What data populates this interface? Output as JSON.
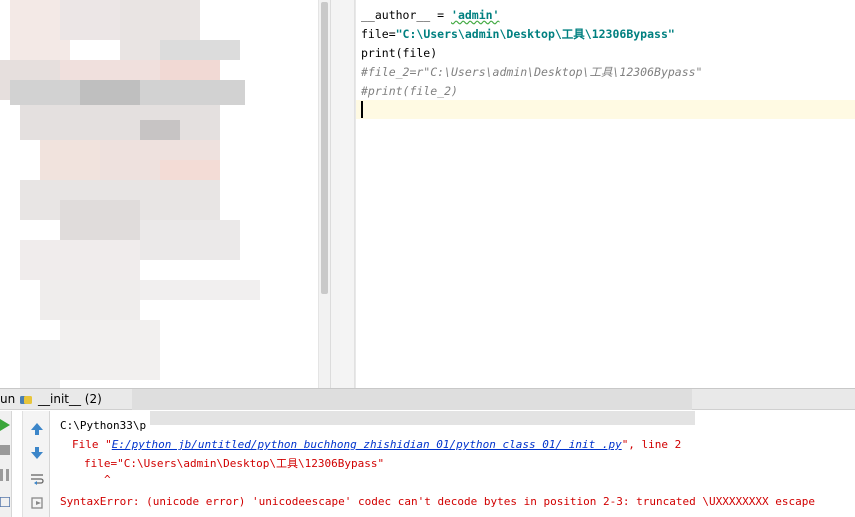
{
  "editor": {
    "lines": [
      {
        "a": "__author__ = ",
        "b": "'admin'"
      },
      {
        "a": "file=",
        "b": "\"C:\\Users\\admin\\Desktop\\工具\\12306Bypass\""
      },
      {
        "a": "print(file)"
      },
      {
        "a": "#file_2=r\"C:\\Users\\admin\\Desktop\\工具\\12306Bypass\""
      },
      {
        "a": "#print(file_2)"
      }
    ]
  },
  "run": {
    "label": "un",
    "tab_label": "__init__ (2)",
    "output": {
      "line1": "C:\\Python33\\p",
      "file_prefix": "File \"",
      "file_path": "E:/python jb/untitled/python buchhong zhishidian 01/python class 01/ init .py",
      "file_suffix": "\", line 2",
      "code_line": "file=\"C:\\Users\\admin\\Desktop\\工具\\12306Bypass\"",
      "caret": "^",
      "error": "SyntaxError: (unicode error) 'unicodeescape' codec can't decode bytes in position 2-3: truncated \\UXXXXXXXX escape"
    }
  },
  "colors": {
    "string": "#008080",
    "comment": "#808080",
    "error": "#d10000",
    "link": "#0033cc",
    "current_line": "#fffae3"
  },
  "icons": {
    "run_tab": "python-file-icon",
    "rerun": "play-icon",
    "stop": "stop-icon",
    "scroll_up": "up-arrow-icon",
    "scroll_down": "down-arrow-icon",
    "soft_wrap": "wrap-icon",
    "print": "export-icon"
  }
}
